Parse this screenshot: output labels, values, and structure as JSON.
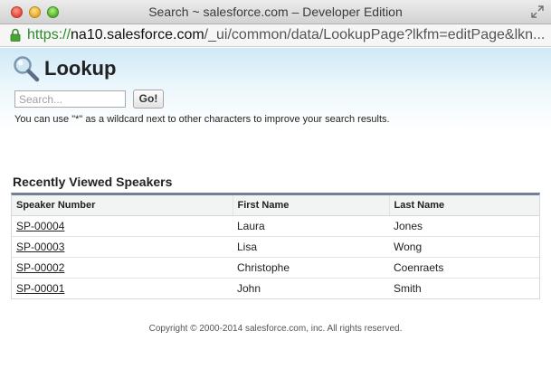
{
  "window": {
    "title": "Search ~ salesforce.com – Developer Edition"
  },
  "urlbar": {
    "scheme": "https://",
    "host": "na10.salesforce.com",
    "path": "/_ui/common/data/LookupPage?lkfm=editPage&lkn..."
  },
  "header": {
    "title": "Lookup",
    "icon": "magnifier-icon"
  },
  "search": {
    "placeholder": "Search...",
    "value": "",
    "go_label": "Go!",
    "hint": "You can use \"*\" as a wildcard next to other characters to improve your search results."
  },
  "results": {
    "title": "Recently Viewed Speakers",
    "columns": [
      "Speaker Number",
      "First Name",
      "Last Name"
    ],
    "rows": [
      {
        "speaker_number": "SP-00004",
        "first_name": "Laura",
        "last_name": "Jones"
      },
      {
        "speaker_number": "SP-00003",
        "first_name": "Lisa",
        "last_name": "Wong"
      },
      {
        "speaker_number": "SP-00002",
        "first_name": "Christophe",
        "last_name": "Coenraets"
      },
      {
        "speaker_number": "SP-00001",
        "first_name": "John",
        "last_name": "Smith"
      }
    ]
  },
  "footer": {
    "copyright": "Copyright © 2000-2014 salesforce.com, inc. All rights reserved."
  },
  "colors": {
    "url_scheme": "#2d8a2d",
    "table_top_border": "#747e96",
    "header_gradient_top": "#cfe9f7"
  }
}
